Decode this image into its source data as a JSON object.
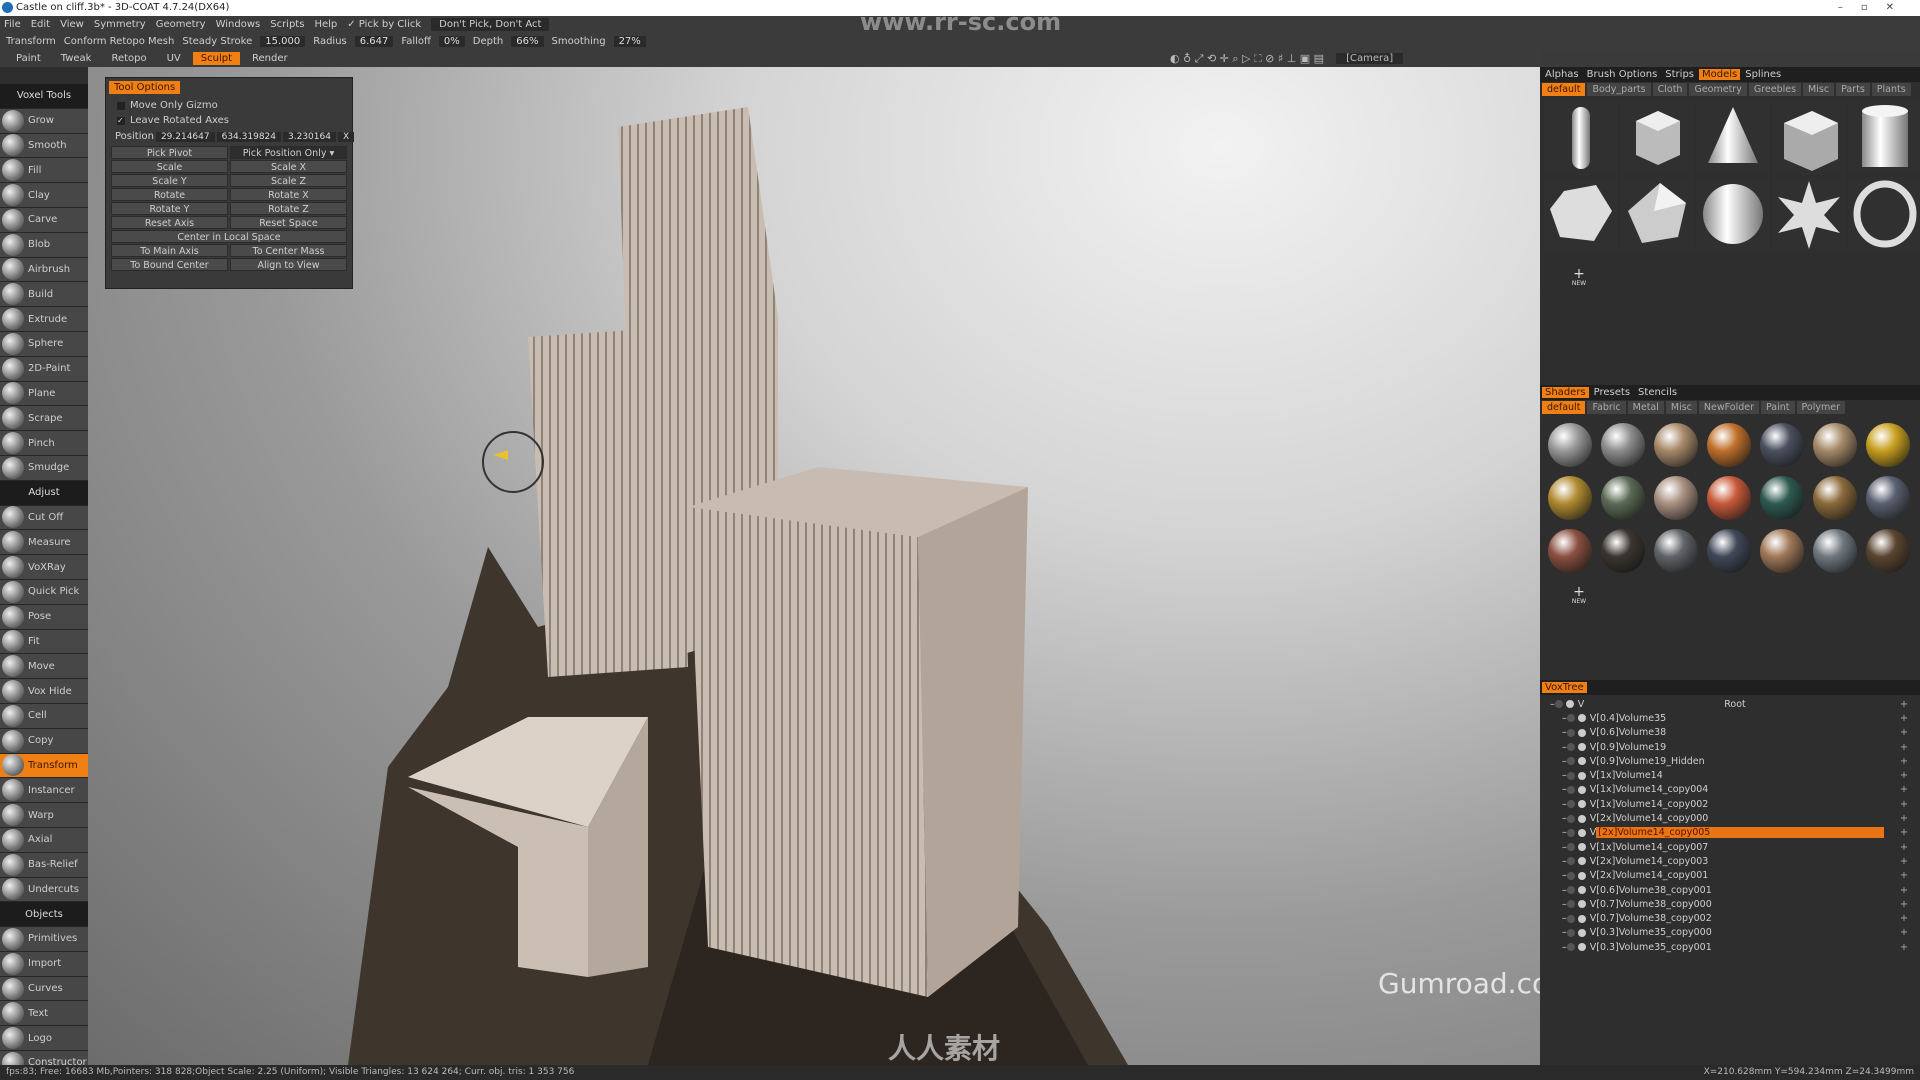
{
  "window": {
    "title": "Castle on cliff.3b* - 3D-COAT 4.7.24(DX64)"
  },
  "menu": [
    "File",
    "Edit",
    "View",
    "Symmetry",
    "Geometry",
    "Windows",
    "Scripts",
    "Help"
  ],
  "pick": {
    "check": "✓ Pick by Click",
    "mode": "Don't Pick, Don't Act"
  },
  "toolbar": {
    "transform": "Transform",
    "conform": "Conform Retopo Mesh",
    "steady": "Steady Stroke",
    "steady_val": "15.000",
    "radius": "Radius",
    "radius_val": "6.647",
    "falloff": "Falloff",
    "falloff_val": "0%",
    "depth": "Depth",
    "depth_val": "66%",
    "smoothing": "Smoothing",
    "smoothing_val": "27%"
  },
  "rooms": [
    "Paint",
    "Tweak",
    "Retopo",
    "UV",
    "Sculpt",
    "Render"
  ],
  "active_room": "Sculpt",
  "camera": "[Camera]",
  "left_tools": [
    {
      "h": "Voxel Tools"
    },
    {
      "l": "Grow"
    },
    {
      "l": "Smooth"
    },
    {
      "l": "Fill"
    },
    {
      "l": "Clay"
    },
    {
      "l": "Carve"
    },
    {
      "l": "Blob"
    },
    {
      "l": "Airbrush"
    },
    {
      "l": "Build"
    },
    {
      "l": "Extrude"
    },
    {
      "l": "Sphere"
    },
    {
      "l": "2D-Paint"
    },
    {
      "l": "Plane"
    },
    {
      "l": "Scrape"
    },
    {
      "l": "Pinch"
    },
    {
      "l": "Smudge"
    },
    {
      "h": "Adjust"
    },
    {
      "l": "Cut Off"
    },
    {
      "l": "Measure"
    },
    {
      "l": "VoXRay"
    },
    {
      "l": "Quick Pick"
    },
    {
      "l": "Pose"
    },
    {
      "l": "Fit"
    },
    {
      "l": "Move"
    },
    {
      "l": "Vox Hide"
    },
    {
      "l": "Cell"
    },
    {
      "l": "Copy"
    },
    {
      "l": "Transform",
      "a": true
    },
    {
      "l": "Instancer"
    },
    {
      "l": "Warp"
    },
    {
      "l": "Axial"
    },
    {
      "l": "Bas-Relief"
    },
    {
      "l": "Undercuts"
    },
    {
      "h": "Objects"
    },
    {
      "l": "Primitives"
    },
    {
      "l": "Import"
    },
    {
      "l": "Curves"
    },
    {
      "l": "Text"
    },
    {
      "l": "Logo"
    },
    {
      "l": "Constructor"
    }
  ],
  "tool_options": {
    "title": "Tool Options",
    "move_only_gizmo": "Move Only Gizmo",
    "leave_rotated_axes": "Leave Rotated Axes",
    "position_label": "Position",
    "position": [
      "29.214647",
      "634.319824",
      "3.230164"
    ],
    "clear": "X",
    "buttons": [
      [
        "Pick Pivot",
        "Pick Position Only ▾"
      ],
      [
        "Scale",
        "Scale X"
      ],
      [
        "Scale Y",
        "Scale Z"
      ],
      [
        "Rotate",
        "Rotate X"
      ],
      [
        "Rotate Y",
        "Rotate Z"
      ],
      [
        "Reset Axis",
        "Reset Space"
      ],
      [
        "Center in Local Space"
      ],
      [
        "To Main Axis",
        "To Center Mass"
      ],
      [
        "To Bound Center",
        "Align to View"
      ]
    ]
  },
  "models_panel": {
    "tabs": [
      "Alphas",
      "Brush Options",
      "Strips",
      "Models",
      "Splines"
    ],
    "active": "Models",
    "folders": [
      "default",
      "Body_parts",
      "Cloth",
      "Geometry",
      "Greebles",
      "Misc",
      "Parts",
      "Plants"
    ],
    "items": [
      "capsule",
      "cube",
      "cone",
      "box",
      "cylinder",
      "dodecahedron",
      "icosahedron",
      "sphere",
      "star",
      "torus"
    ],
    "new": "NEW"
  },
  "shaders_panel": {
    "tabs": [
      "Shaders",
      "Presets",
      "Stencils"
    ],
    "folders": [
      "default",
      "Fabric",
      "Metal",
      "Misc",
      "NewFolder",
      "Paint",
      "Polymer"
    ],
    "colors": [
      "#9a9a9a",
      "#8e8e8e",
      "#a88a6a",
      "#c0702c",
      "#4a5060",
      "#a58a6a",
      "#c8a020",
      "#b08a30",
      "#5a6a55",
      "#a89080",
      "#c85a3a",
      "#2e5a50",
      "#8a6a3a",
      "#5a6070",
      "#8a5040",
      "#3a3530",
      "#606468",
      "#404858",
      "#a07858",
      "#707880",
      "#5a4530"
    ],
    "new": "NEW"
  },
  "voxtree": {
    "title": "VoxTree",
    "root": "Root",
    "items": [
      "[0.4]Volume35",
      "[0.6]Volume38",
      "[0.9]Volume19",
      "[0.9]Volume19_Hidden",
      "[1x]Volume14",
      "[1x]Volume14_copy004",
      "[1x]Volume14_copy002",
      "[2x]Volume14_copy000",
      "[2x]Volume14_copy005",
      "[1x]Volume14_copy007",
      "[2x]Volume14_copy003",
      "[2x]Volume14_copy001",
      "[0.6]Volume38_copy001",
      "[0.7]Volume38_copy000",
      "[0.7]Volume38_copy002",
      "[0.3]Volume35_copy000",
      "[0.3]Volume35_copy001"
    ],
    "selected": "[2x]Volume14_copy005"
  },
  "status": {
    "text": "fps:83;    Free: 16683 Mb,Pointers: 318 828;Object Scale: 2.25 (Uniform); Visible Triangles: 13 624 264; Curr. obj. tris: 1 353 756",
    "coords": "X=210.628mm  Y=594.234mm  Z=24.3499mm"
  },
  "watermarks": {
    "top": "www.rr-sc.com",
    "gumroad": "Gumroad.com/eytanzana",
    "bottom": "人人素材"
  },
  "accent": "#f07f14"
}
